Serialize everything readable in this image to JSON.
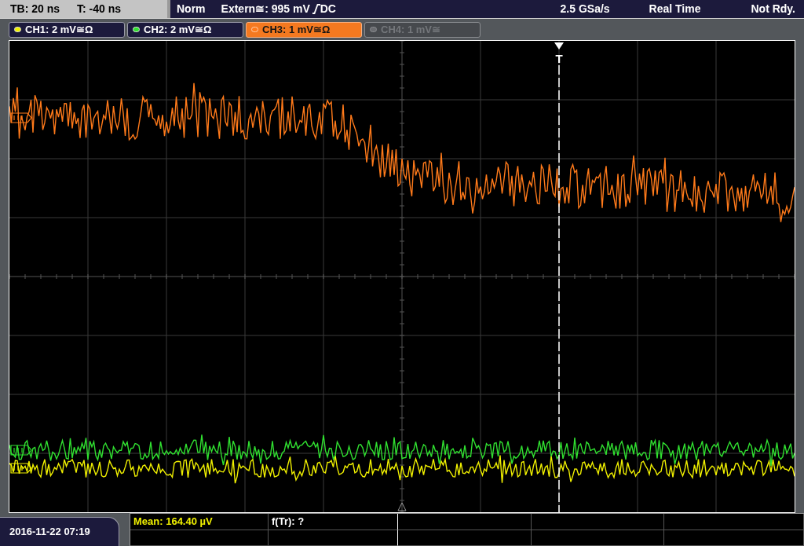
{
  "status_bar": {
    "timebase": "TB: 20 ns",
    "trigger_time": "T: -40 ns",
    "trigger_mode": "Norm",
    "trigger_source": "Extern≅: 995 mV",
    "trigger_coupling": "DC",
    "sample_rate": "2.5 GSa/s",
    "acquisition_mode": "Real Time",
    "status": "Not Rdy."
  },
  "channels": [
    {
      "label": "CH1: 2 mV≅Ω",
      "color": "#f0f000",
      "on": true,
      "selected": false
    },
    {
      "label": "CH2: 2 mV≅Ω",
      "color": "#30e030",
      "on": true,
      "selected": false
    },
    {
      "label": "CH3: 1 mV≅Ω",
      "color": "#ff7a1a",
      "on": true,
      "selected": true
    },
    {
      "label": "CH4: 1 mV≅",
      "color": "#6a6c70",
      "on": false,
      "selected": false
    }
  ],
  "trigger_marker": {
    "label": "T"
  },
  "date_time": "2016-11-22 07:19",
  "measurements": [
    {
      "text": "Mean: 164.40 µV",
      "color": "#f0f000"
    },
    {
      "text": "f(Tr): ?",
      "color": "#ffffff"
    }
  ]
}
